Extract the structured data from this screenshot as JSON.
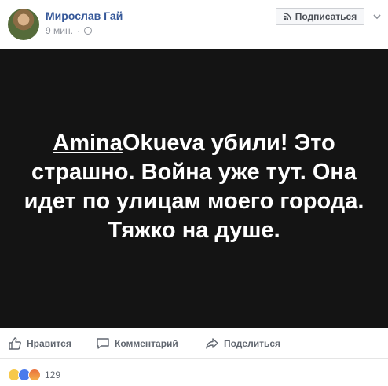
{
  "post": {
    "author": "Мирослав Гай",
    "time": "9 мин.",
    "separator": "·",
    "subscribe_label": "Подписаться",
    "text_mention": "Amina",
    "text_body": "Okueva убили! Это страшно. Война уже тут. Она идет по улицам моего города. Тяжко на душе."
  },
  "actions": {
    "like_label": "Нравится",
    "comment_label": "Комментарий",
    "share_label": "Поделиться"
  },
  "reactions": {
    "count": "129",
    "icons": [
      "sad-reaction-icon",
      "like-reaction-icon",
      "angry-reaction-icon"
    ]
  },
  "colors": {
    "author": "#365899",
    "post_background": "#141414",
    "post_text": "#ffffff",
    "action_text": "#616770"
  }
}
